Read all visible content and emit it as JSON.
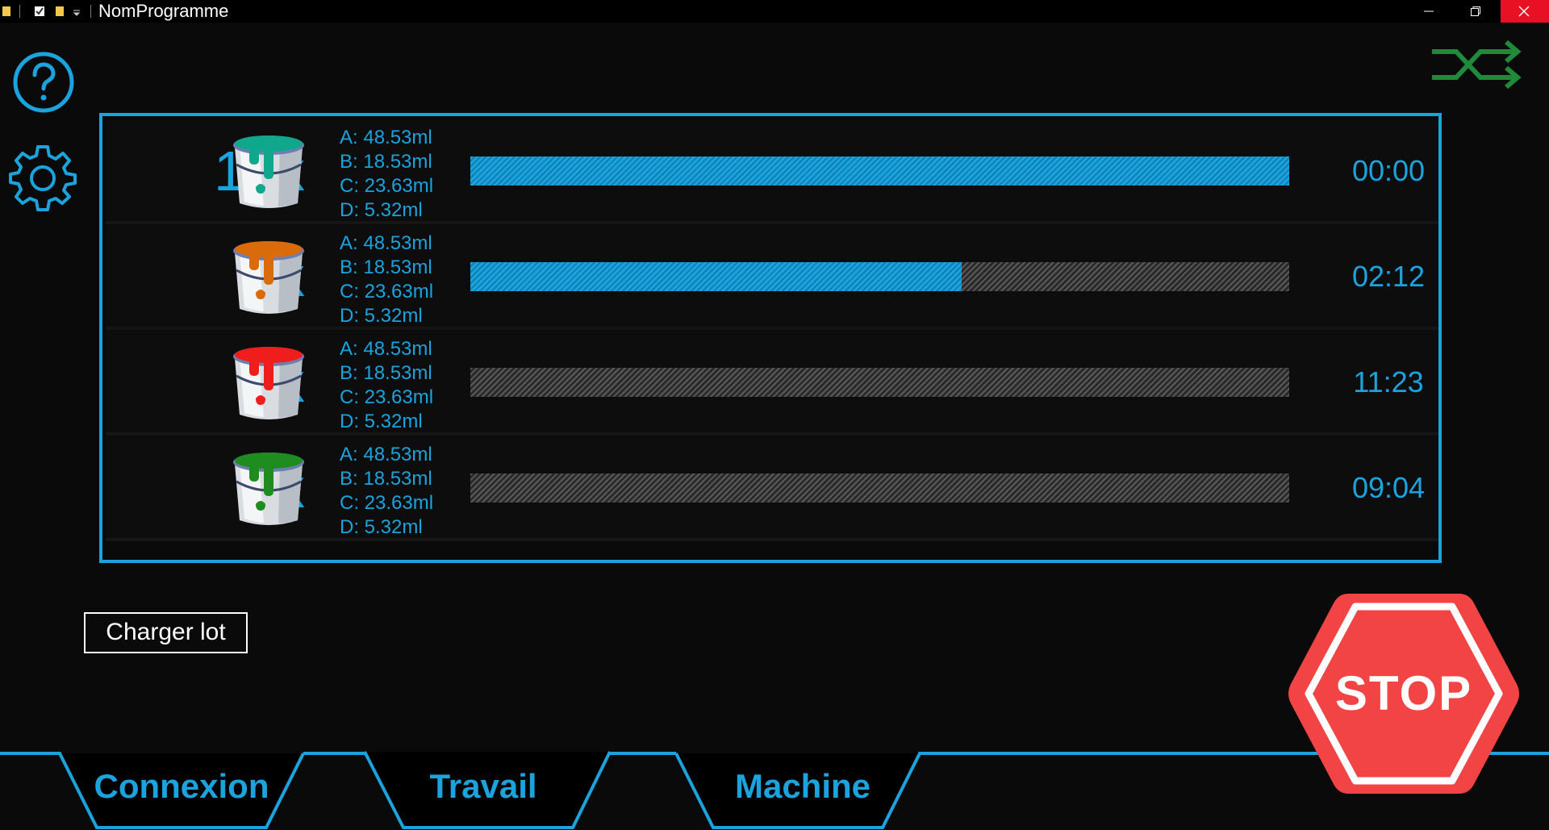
{
  "window": {
    "title": "NomProgramme",
    "minimize_icon": "minimize-icon",
    "maximize_icon": "restore-icon",
    "close_icon": "close-icon",
    "close_color": "#e81123"
  },
  "accent_color": "#1ba3de",
  "toolbar": {
    "help_icon": "help-icon",
    "settings_icon": "gear-icon",
    "switch_icon": "shuffle-icon",
    "switch_color": "#1f8a3a"
  },
  "jobs": [
    {
      "quantity": "12x",
      "color": "#0fa88c",
      "a": "A: 48.53ml",
      "b": "B: 18.53ml",
      "c": "C: 23.63ml",
      "d": "D: 5.32ml",
      "progress": 1.0,
      "time": "00:00"
    },
    {
      "quantity": "9x",
      "color": "#d96b0b",
      "a": "A: 48.53ml",
      "b": "B: 18.53ml",
      "c": "C: 23.63ml",
      "d": "D: 5.32ml",
      "progress": 0.6,
      "time": "02:12"
    },
    {
      "quantity": "8x",
      "color": "#f01d1d",
      "a": "A: 48.53ml",
      "b": "B: 18.53ml",
      "c": "C: 23.63ml",
      "d": "D: 5.32ml",
      "progress": 0.0,
      "time": "11:23"
    },
    {
      "quantity": "5x",
      "color": "#1e8c1e",
      "a": "A: 48.53ml",
      "b": "B: 18.53ml",
      "c": "C: 23.63ml",
      "d": "D: 5.32ml",
      "progress": 0.0,
      "time": "09:04"
    }
  ],
  "actions": {
    "load_batch": "Charger lot",
    "stop": "STOP",
    "stop_color": "#f24444"
  },
  "tabs": [
    {
      "label": "Connexion",
      "active": false
    },
    {
      "label": "Travail",
      "active": true
    },
    {
      "label": "Machine",
      "active": false
    }
  ]
}
